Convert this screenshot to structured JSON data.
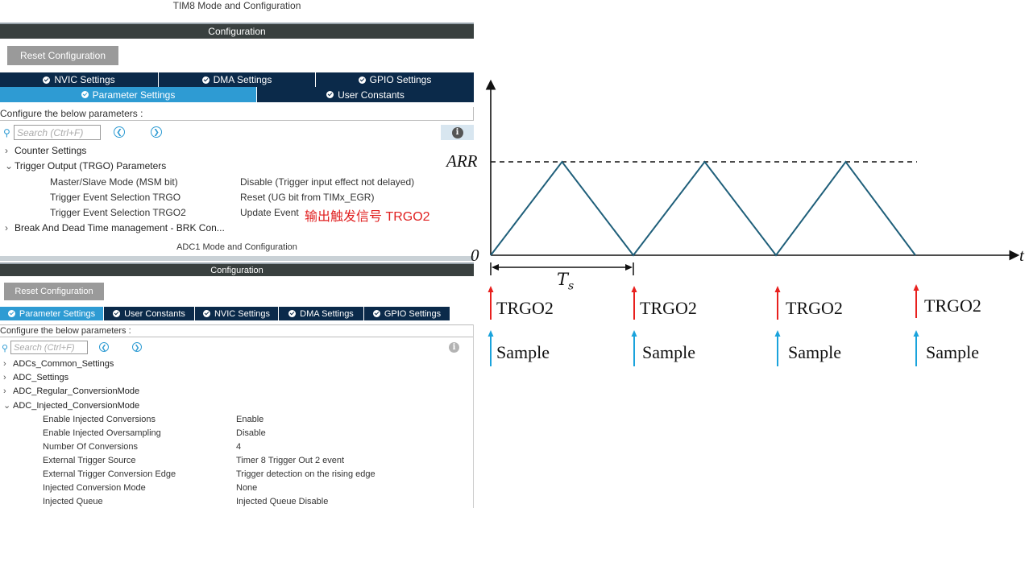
{
  "tim8": {
    "title": "TIM8 Mode and Configuration",
    "config_label": "Configuration",
    "reset_label": "Reset Configuration",
    "tabs_row1": [
      "NVIC Settings",
      "DMA Settings",
      "GPIO Settings"
    ],
    "tabs_row2": [
      "Parameter Settings",
      "User Constants"
    ],
    "active_tab": "Parameter Settings",
    "configure_text": "Configure the below parameters :",
    "search_placeholder": "Search (Ctrl+F)",
    "tree": {
      "counter": "Counter Settings",
      "trgo": "Trigger Output (TRGO) Parameters",
      "brk": "Break And Dead Time management - BRK Con..."
    },
    "params": [
      {
        "name": "Master/Slave Mode (MSM bit)",
        "value": "Disable (Trigger input effect not delayed)"
      },
      {
        "name": "Trigger Event Selection TRGO",
        "value": "Reset (UG bit from TIMx_EGR)"
      },
      {
        "name": "Trigger Event Selection TRGO2",
        "value": "Update Event"
      }
    ],
    "note": "输出触发信号 TRGO2"
  },
  "adc1": {
    "title": "ADC1 Mode and Configuration",
    "config_label": "Configuration",
    "reset_label": "Reset Configuration",
    "tabs": [
      "Parameter Settings",
      "User Constants",
      "NVIC Settings",
      "DMA Settings",
      "GPIO Settings"
    ],
    "active_tab": "Parameter Settings",
    "configure_text": "Configure the below parameters :",
    "search_placeholder": "Search (Ctrl+F)",
    "tree": {
      "common": "ADCs_Common_Settings",
      "settings": "ADC_Settings",
      "regular": "ADC_Regular_ConversionMode",
      "injected": "ADC_Injected_ConversionMode"
    },
    "params": [
      {
        "name": "Enable Injected Conversions",
        "value": "Enable"
      },
      {
        "name": "Enable Injected Oversampling",
        "value": "Disable"
      },
      {
        "name": "Number Of Conversions",
        "value": "4"
      },
      {
        "name": "External Trigger Source",
        "value": "Timer 8 Trigger Out 2 event"
      },
      {
        "name": "External Trigger Conversion Edge",
        "value": "Trigger detection on the rising edge"
      },
      {
        "name": "Injected Conversion Mode",
        "value": "None"
      },
      {
        "name": "Injected Queue",
        "value": "Injected Queue Disable"
      }
    ]
  },
  "diagram": {
    "arr_label": "ARR",
    "origin_label": "0",
    "t_label": "t",
    "ts_label": "T",
    "ts_sub": "s",
    "trgo_label": "TRGO2",
    "sample_label": "Sample",
    "period_count": 3,
    "wave_color": "#1f5f7a",
    "trgo_color": "#e8201e",
    "sample_color": "#1aa3dc"
  }
}
